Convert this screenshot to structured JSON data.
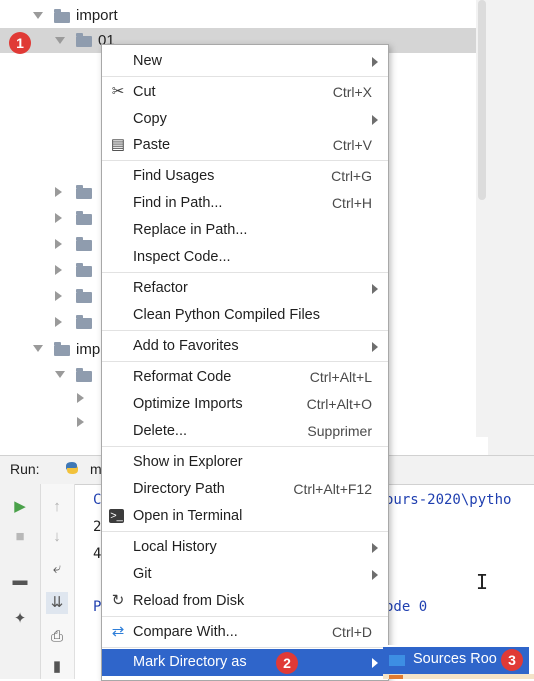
{
  "tree": {
    "rows": [
      {
        "label": "import",
        "expanded": true,
        "selected": false
      },
      {
        "label": "01",
        "expanded": true,
        "selected": true
      }
    ],
    "partial_label": "imp"
  },
  "badges": [
    "1",
    "2",
    "3"
  ],
  "run": {
    "label": "Run:",
    "tab_fragment": "m",
    "console": {
      "line1_start": "C",
      "line1_end": "ours-2020\\pytho",
      "line2": "2",
      "line3": "4",
      "line4_start": "P",
      "line4_end": "ode 0"
    }
  },
  "menu": {
    "items": [
      {
        "label": "New",
        "shortcut": "",
        "submenu": true,
        "icon": ""
      },
      {
        "label": "Cut",
        "shortcut": "Ctrl+X",
        "submenu": false,
        "icon": "scissors-icon"
      },
      {
        "label": "Copy",
        "shortcut": "",
        "submenu": true,
        "icon": ""
      },
      {
        "label": "Paste",
        "shortcut": "Ctrl+V",
        "submenu": false,
        "icon": "clipboard-icon"
      },
      {
        "label": "Find Usages",
        "shortcut": "Ctrl+G",
        "submenu": false,
        "icon": ""
      },
      {
        "label": "Find in Path...",
        "shortcut": "Ctrl+H",
        "submenu": false,
        "icon": ""
      },
      {
        "label": "Replace in Path...",
        "shortcut": "",
        "submenu": false,
        "icon": ""
      },
      {
        "label": "Inspect Code...",
        "shortcut": "",
        "submenu": false,
        "icon": ""
      },
      {
        "label": "Refactor",
        "shortcut": "",
        "submenu": true,
        "icon": ""
      },
      {
        "label": "Clean Python Compiled Files",
        "shortcut": "",
        "submenu": false,
        "icon": ""
      },
      {
        "label": "Add to Favorites",
        "shortcut": "",
        "submenu": true,
        "icon": ""
      },
      {
        "label": "Reformat Code",
        "shortcut": "Ctrl+Alt+L",
        "submenu": false,
        "icon": ""
      },
      {
        "label": "Optimize Imports",
        "shortcut": "Ctrl+Alt+O",
        "submenu": false,
        "icon": ""
      },
      {
        "label": "Delete...",
        "shortcut": "Supprimer",
        "submenu": false,
        "icon": ""
      },
      {
        "label": "Show in Explorer",
        "shortcut": "",
        "submenu": false,
        "icon": ""
      },
      {
        "label": "Directory Path",
        "shortcut": "Ctrl+Alt+F12",
        "submenu": false,
        "icon": ""
      },
      {
        "label": "Open in Terminal",
        "shortcut": "",
        "submenu": false,
        "icon": "terminal-icon"
      },
      {
        "label": "Local History",
        "shortcut": "",
        "submenu": true,
        "icon": ""
      },
      {
        "label": "Git",
        "shortcut": "",
        "submenu": true,
        "icon": ""
      },
      {
        "label": "Reload from Disk",
        "shortcut": "",
        "submenu": false,
        "icon": "reload-icon"
      },
      {
        "label": "Compare With...",
        "shortcut": "Ctrl+D",
        "submenu": false,
        "icon": "compare-icon"
      },
      {
        "label": "Mark Directory as",
        "shortcut": "",
        "submenu": true,
        "icon": "",
        "highlighted": true
      }
    ]
  },
  "submenu": {
    "item": "Sources Roo"
  },
  "colors": {
    "highlight": "#2f65ca",
    "badge": "#e03a36",
    "selection": "#d5d5d5"
  }
}
